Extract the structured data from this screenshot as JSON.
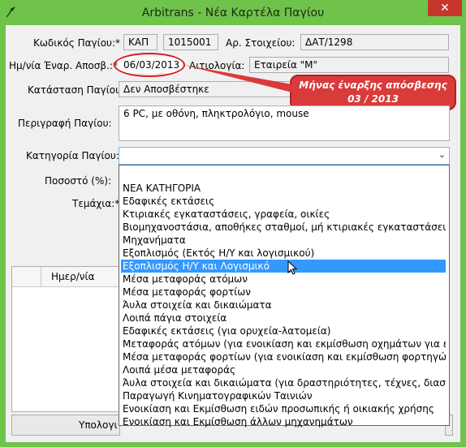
{
  "window": {
    "title": "Arbitrans - Νέα Καρτέλα Παγίου",
    "close_glyph": "✕",
    "app_icon": "feather-icon"
  },
  "form": {
    "code_label": "Κωδικός Παγίου:*",
    "code_prefix": "ΚΑΠ",
    "code_number": "1015001",
    "ref_label": "Αρ. Στοιχείου:",
    "ref_value": "ΔΑΤ/1298",
    "date_label": "Ημ/νία Έναρ. Αποσβ.:*",
    "date_value": "06/03/2013",
    "reason_label": "Αιτιολογία:",
    "reason_value": "Εταιρεία \"Μ\"",
    "status_label": "Κατάσταση Παγίου:*",
    "status_value": "Δεν Αποσβέστηκε",
    "desc_label": "Περιγραφή Παγίου:",
    "desc_value": "6 PC, με οθόνη, πληκτρολόγιο, mouse",
    "category_label": "Κατηγορία Παγίου:*",
    "category_value": "",
    "percent_label": "Ποσοστό (%):",
    "pieces_label": "Τεμάχια:*"
  },
  "callout": {
    "line1": "Μήνας έναρξης απόσβεσης",
    "line2": "03 / 2013"
  },
  "dropdown": {
    "selected_index": 6,
    "items": [
      "",
      "ΝΕΑ ΚΑΤΗΓΟΡΙΑ",
      "Εδαφικές εκτάσεις",
      "Κτιριακές εγκαταστάσεις, γραφεία, οικίες",
      "Βιομηχανοστάσια, αποθήκες σταθμοί, μή κτιριακές εγκαταστάσεις",
      "Μηχανήματα",
      "Εξοπλισμός (Εκτός Η/Υ και λογισμικού)",
      "Εξοπλισμός Η/Υ και Λογισμικό",
      "Μέσα μεταφοράς ατόμων",
      "Μέσα μεταφοράς φορτίων",
      "Άυλα στοιχεία και δικαιώματα",
      "Λοιπά πάγια στοιχεία",
      "Εδαφικές εκτάσεις (για ορυχεία-λατομεία)",
      "Μεταφοράς ατόμων (για ενοικίαση και εκμίσθωση οχημάτων για εκπαί",
      "Μέσα μεταφοράς φορτίων (για ενοικίαση και εκμίσθωση φορτηγών)",
      "Λοιπά μέσα μεταφοράς",
      "Άυλα στοιχεία και δικαιώματα (για δραστηριότητες, τέχνες, διασκέδα",
      "Παραγωγή Κινηματογραφικών Ταινιών",
      "Ενοικίαση και Εκμίσθωση ειδών προσωπικής ή οικιακής χρήσης",
      "Ενοικίαση και Εκμίσθωση άλλων μηχανημάτων"
    ]
  },
  "grid": {
    "column_date": "Ημερ/νία"
  },
  "buttons": {
    "calculate_label": "Υπολογι"
  }
}
